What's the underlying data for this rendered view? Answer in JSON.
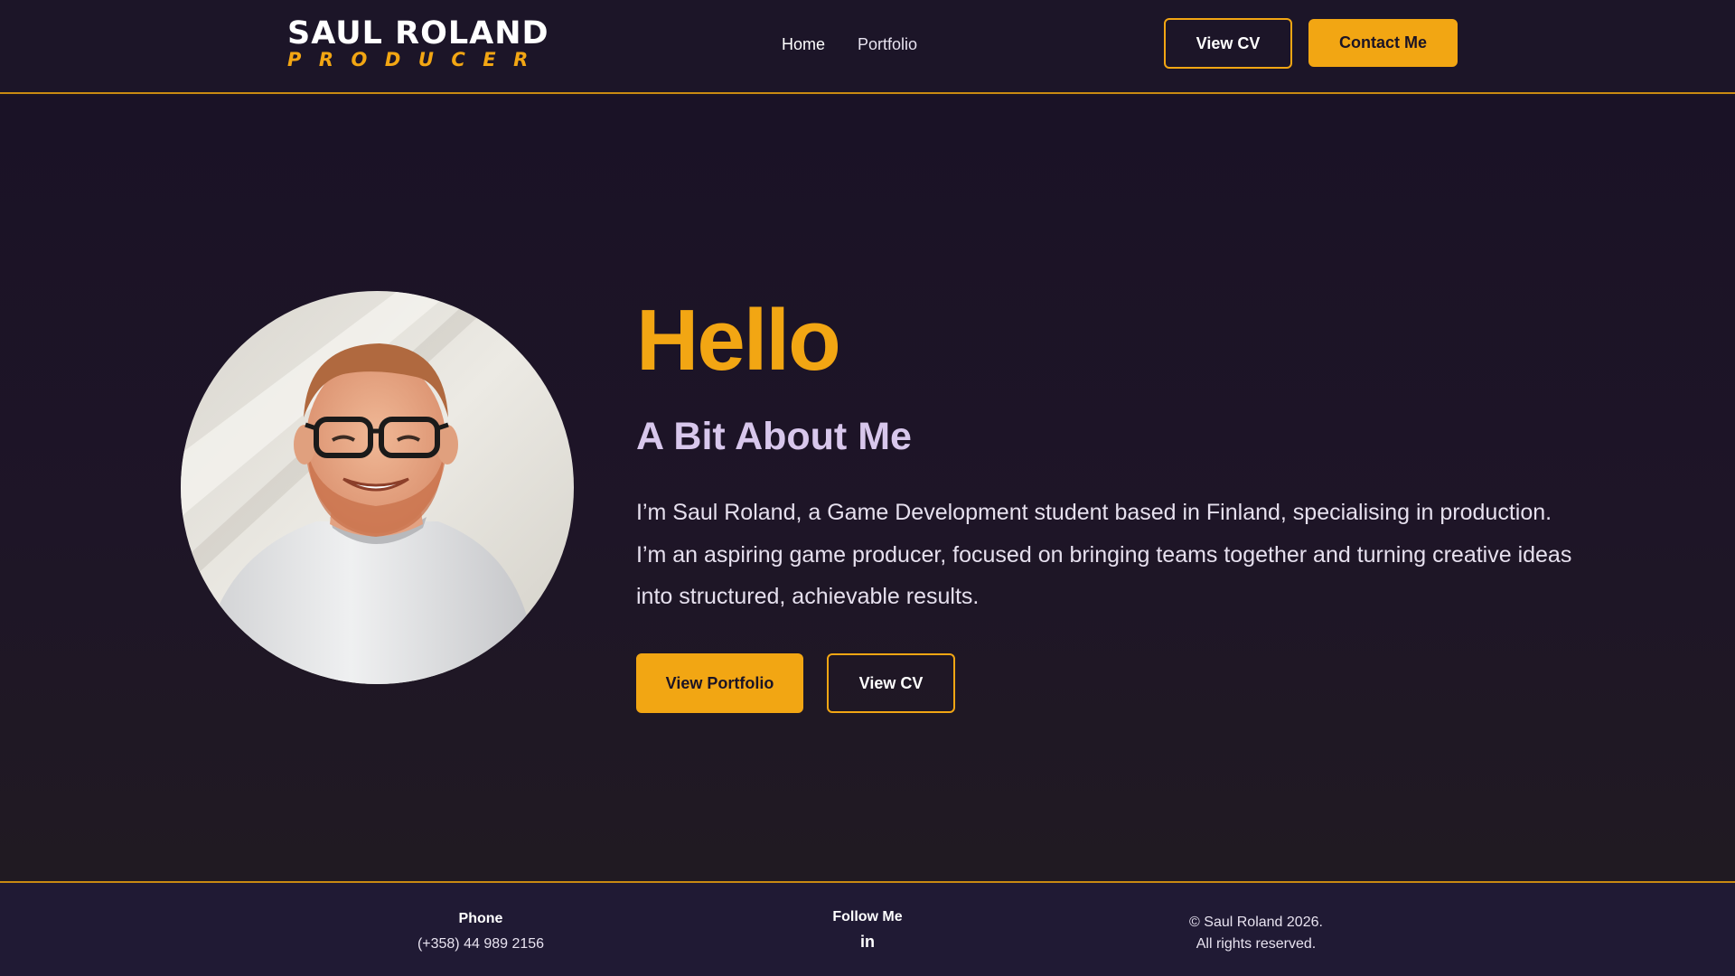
{
  "header": {
    "logo_name": "SAUL ROLAND",
    "logo_role": "PRODUCER",
    "nav": [
      {
        "label": "Home"
      },
      {
        "label": "Portfolio"
      }
    ],
    "view_cv_label": "View CV",
    "contact_label": "Contact Me"
  },
  "main": {
    "heading": "Hello",
    "subtitle": "A Bit About Me",
    "bio": "I’m Saul Roland, a Game Development student based in Finland, specialising in production. I’m an aspiring game producer, focused on bringing teams together and turning creative ideas into structured, achievable results.",
    "view_portfolio_label": "View Portfolio",
    "view_cv_label": "View CV"
  },
  "footer": {
    "phone_title": "Phone",
    "phone_number": "(+358) 44 989 2156",
    "follow_title": "Follow Me",
    "linkedin_label": "in",
    "copyright": "© Saul Roland 2026.",
    "rights": "All rights reserved."
  },
  "colors": {
    "accent": "#f2a613",
    "background": "#1b1425",
    "footer_background": "#201a34",
    "subtitle": "#d8c7ec"
  },
  "icons": [
    "linkedin-icon"
  ]
}
